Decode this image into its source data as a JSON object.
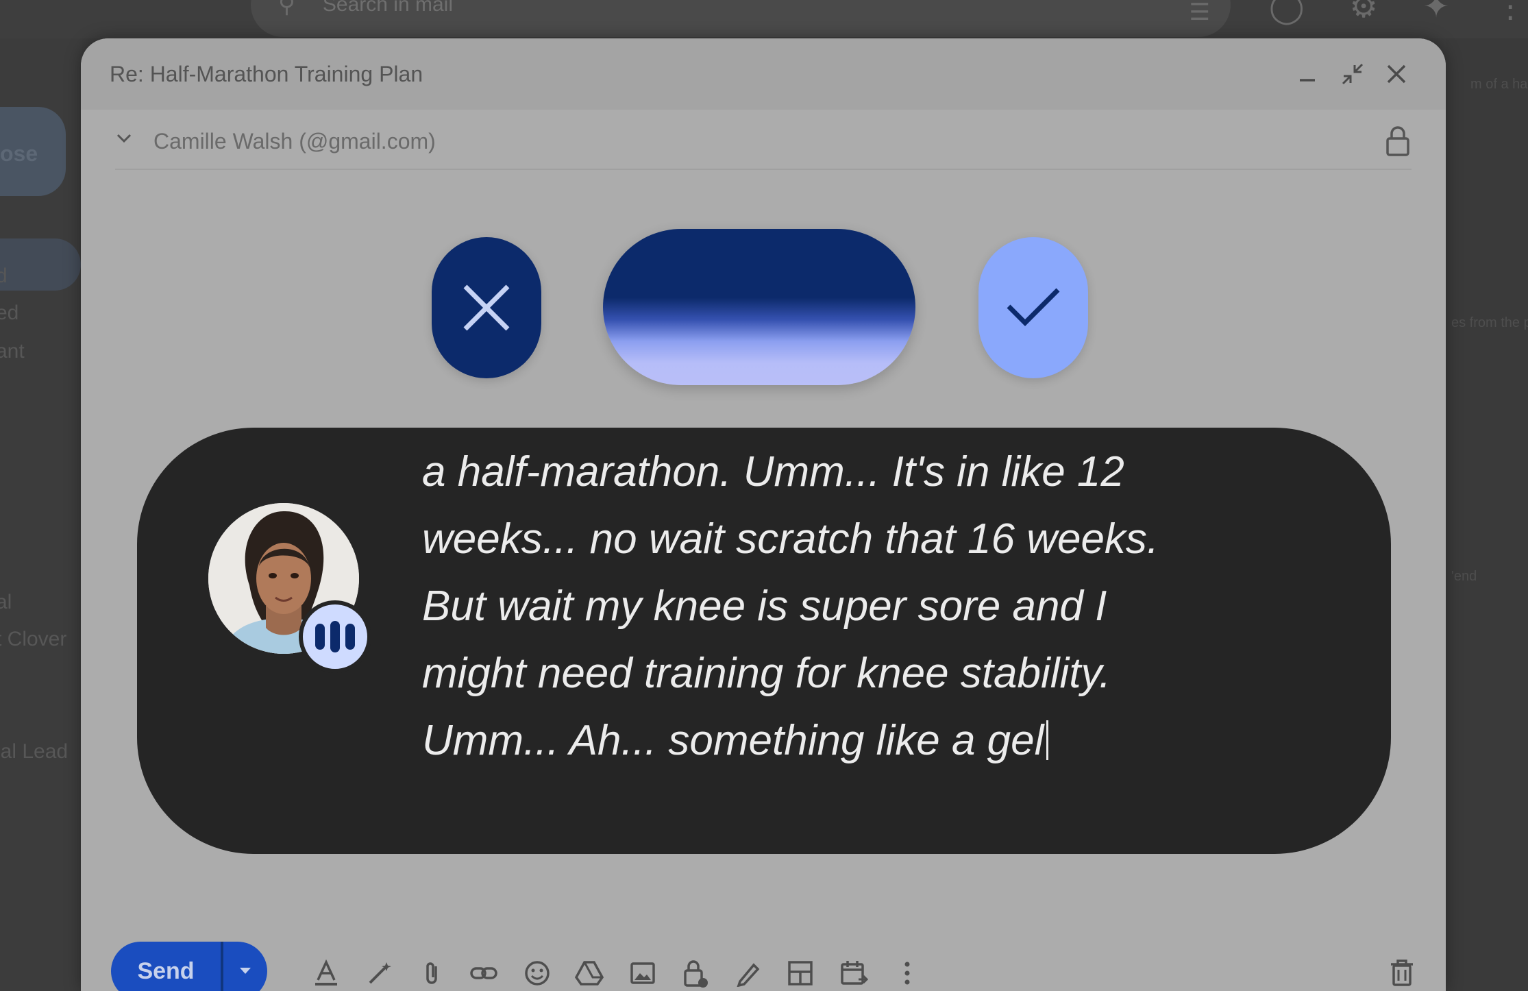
{
  "background": {
    "search_placeholder": "Search in mail",
    "compose_label": "ose",
    "nav_items": [
      "d",
      "ed",
      "ant",
      "al",
      "t Clover",
      "ial Lead"
    ],
    "right_text": [
      "m of a hal",
      "es from the p",
      "'end"
    ]
  },
  "compose": {
    "title": "Re: Half-Marathon Training Plan",
    "recipient": "Camille Walsh (@gmail.com)",
    "window_controls": {
      "minimize_icon": "minimize-icon",
      "expand_icon": "exit-fullscreen-icon",
      "close_icon": "close-icon"
    }
  },
  "voice_controls": {
    "cancel_icon": "close-icon",
    "confirm_icon": "check-icon",
    "colors": {
      "cancel": "#0c2a6b",
      "confirm": "#8aa8fc",
      "wave_top": "#0c2a6b",
      "wave_bottom": "#b9bff8"
    }
  },
  "transcript": {
    "lines": [
      "a half-marathon. Umm... It's in like 12",
      "weeks... no wait scratch that 16 weeks.",
      "But wait my knee is super sore and I",
      "might need training for knee stability.",
      "Umm... Ah... something like a gel"
    ],
    "badge_icon": "audio-bars-icon"
  },
  "toolbar": {
    "send_label": "Send",
    "icons": [
      "format-text-icon",
      "magic-wand-icon",
      "attach-icon",
      "link-icon",
      "emoji-icon",
      "drive-icon",
      "photo-icon",
      "confidential-lock-icon",
      "signature-pen-icon",
      "layout-icon",
      "schedule-calendar-icon",
      "more-options-icon",
      "delete-trash-icon"
    ]
  }
}
